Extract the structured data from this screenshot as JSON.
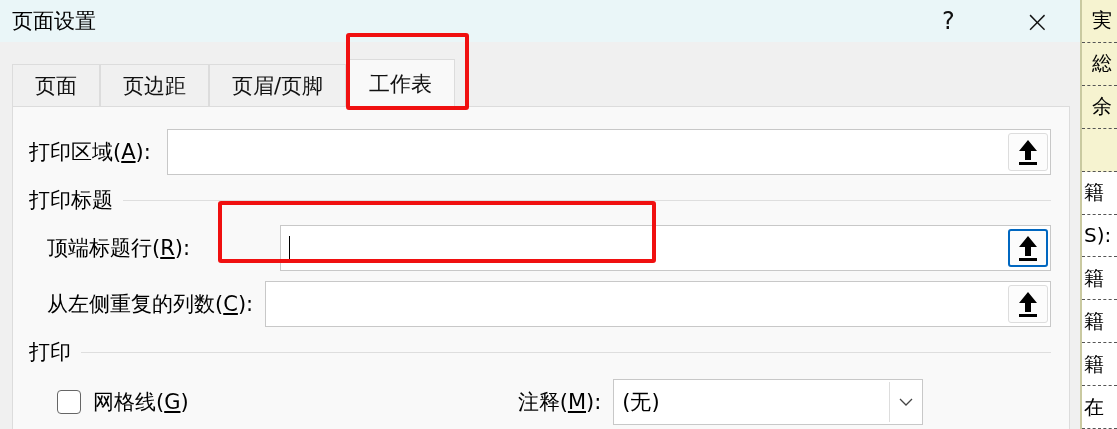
{
  "window": {
    "title": "页面设置",
    "help": "?",
    "close": "×"
  },
  "tabs": [
    {
      "label": "页面",
      "selected": false,
      "highlighted": false
    },
    {
      "label": "页边距",
      "selected": false,
      "highlighted": false
    },
    {
      "label": "页眉/页脚",
      "selected": false,
      "highlighted": false
    },
    {
      "label": "工作表",
      "selected": true,
      "highlighted": true
    }
  ],
  "print_area": {
    "before": "打印区域(",
    "key": "A",
    "after": "):",
    "focused": false
  },
  "print_titles": {
    "heading": "打印标题",
    "rows": [
      {
        "before": "顶端标题行(",
        "key": "R",
        "after": "):",
        "focused": true,
        "highlighted": true
      },
      {
        "before": "从左侧重复的列数(",
        "key": "C",
        "after": "):",
        "focused": false,
        "highlighted": false
      }
    ]
  },
  "print": {
    "heading": "打印",
    "gridlines": {
      "before": "网格线(",
      "key": "G",
      "after": ")",
      "checked": false
    },
    "comments": {
      "before": "注释(",
      "key": "M",
      "after": "):",
      "value": "(无)"
    }
  },
  "sheet_behind": {
    "cells": [
      {
        "text": "実",
        "kind": "header"
      },
      {
        "text": "総",
        "kind": "header"
      },
      {
        "text": "余",
        "kind": "header"
      },
      {
        "text": "",
        "kind": "header"
      },
      {
        "text": "籍",
        "kind": "body"
      },
      {
        "text": "S):",
        "kind": "body"
      },
      {
        "text": "籍",
        "kind": "body"
      },
      {
        "text": "籍",
        "kind": "body"
      },
      {
        "text": "籍",
        "kind": "body"
      },
      {
        "text": "在",
        "kind": "body"
      }
    ]
  }
}
